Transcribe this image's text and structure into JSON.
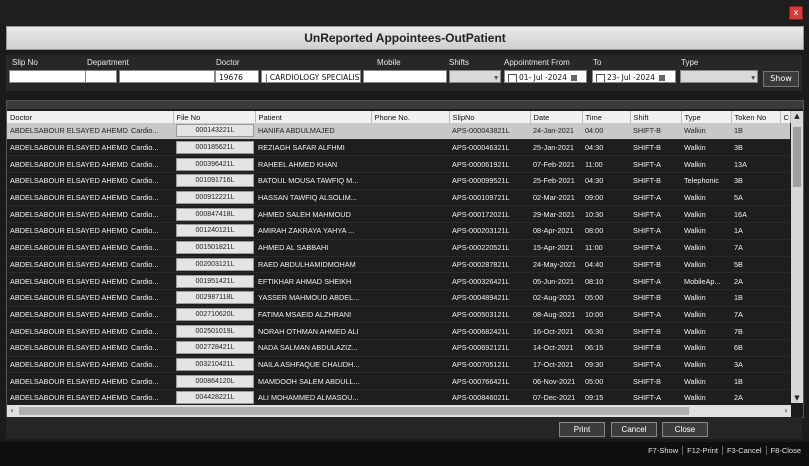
{
  "window": {
    "title": "UnReported Appointees-OutPatient",
    "close_label": "x"
  },
  "filters": {
    "slip_no": {
      "label": "Slip No",
      "value": ""
    },
    "department": {
      "label": "Department",
      "value": ""
    },
    "doctor": {
      "label": "Doctor",
      "code": "19676",
      "name": "|  CARDIOLOGY SPECIALIST"
    },
    "mobile": {
      "label": "Mobile",
      "value": ""
    },
    "shifts": {
      "label": "Shifts",
      "value": ""
    },
    "appointment_from": {
      "label": "Appointment From",
      "value": "01- Jul -2024"
    },
    "to": {
      "label": "To",
      "value": "23- Jul -2024"
    },
    "type": {
      "label": "Type",
      "value": ""
    },
    "show_label": "Show"
  },
  "grid": {
    "columns": [
      "Doctor",
      "File No",
      "Patient",
      "Phone No.",
      "SlipNo",
      "Date",
      "Time",
      "Shift",
      "Type",
      "Token No",
      "C"
    ],
    "rows": [
      {
        "doctor": "ABDELSABOUR ELSAYED AHEMD",
        "dept": "Cardio...",
        "file": "000143221L",
        "patient": "HANIFA ABDULMAJED",
        "phone": "",
        "slip": "APS-000043821L",
        "date": "24-Jan-2021",
        "time": "04:00",
        "shift": "SHIFT-B",
        "type": "Walkin",
        "token": "1B"
      },
      {
        "doctor": "ABDELSABOUR ELSAYED AHEMD",
        "dept": "Cardio...",
        "file": "000185621L",
        "patient": "REZIAGH SAFAR ALFHMI",
        "phone": "",
        "slip": "APS-000046321L",
        "date": "25-Jan-2021",
        "time": "04:30",
        "shift": "SHIFT-B",
        "type": "Walkin",
        "token": "3B"
      },
      {
        "doctor": "ABDELSABOUR ELSAYED AHEMD",
        "dept": "Cardio...",
        "file": "000396421L",
        "patient": "RAHEEL AHMED KHAN",
        "phone": "",
        "slip": "APS-000061921L",
        "date": "07-Feb-2021",
        "time": "11:00",
        "shift": "SHIFT-A",
        "type": "Walkin",
        "token": "13A"
      },
      {
        "doctor": "ABDELSABOUR ELSAYED AHEMD",
        "dept": "Cardio...",
        "file": "001091716L",
        "patient": "BATOUL MOUSA TAWFIQ M...",
        "phone": "",
        "slip": "APS-000099521L",
        "date": "25-Feb-2021",
        "time": "04:30",
        "shift": "SHIFT-B",
        "type": "Telephonic",
        "token": "3B"
      },
      {
        "doctor": "ABDELSABOUR ELSAYED AHEMD",
        "dept": "Cardio...",
        "file": "000912221L",
        "patient": "HASSAN TAWFIQ ALSOLIM...",
        "phone": "",
        "slip": "APS-000109721L",
        "date": "02-Mar-2021",
        "time": "09:00",
        "shift": "SHIFT-A",
        "type": "Walkin",
        "token": "5A"
      },
      {
        "doctor": "ABDELSABOUR ELSAYED AHEMD",
        "dept": "Cardio...",
        "file": "000847418L",
        "patient": "AHMED SALEH MAHMOUD",
        "phone": "",
        "slip": "APS-000172021L",
        "date": "29-Mar-2021",
        "time": "10:30",
        "shift": "SHIFT-A",
        "type": "Walkin",
        "token": "16A"
      },
      {
        "doctor": "ABDELSABOUR ELSAYED AHEMD",
        "dept": "Cardio...",
        "file": "001240121L",
        "patient": "AMIRAH ZAKRAYA YAHYA ...",
        "phone": "",
        "slip": "APS-000203121L",
        "date": "08-Apr-2021",
        "time": "08:00",
        "shift": "SHIFT-A",
        "type": "Walkin",
        "token": "1A"
      },
      {
        "doctor": "ABDELSABOUR ELSAYED AHEMD",
        "dept": "Cardio...",
        "file": "001501821L",
        "patient": "AHMED AL SABBAHI",
        "phone": "",
        "slip": "APS-000220521L",
        "date": "15-Apr-2021",
        "time": "11:00",
        "shift": "SHIFT-A",
        "type": "Walkin",
        "token": "7A"
      },
      {
        "doctor": "ABDELSABOUR ELSAYED AHEMD",
        "dept": "Cardio...",
        "file": "002003121L",
        "patient": "RAED ABDULHAMIDMOHAM",
        "phone": "",
        "slip": "APS-000287821L",
        "date": "24-May-2021",
        "time": "04:40",
        "shift": "SHIFT-B",
        "type": "Walkin",
        "token": "5B"
      },
      {
        "doctor": "ABDELSABOUR ELSAYED AHEMD",
        "dept": "Cardio...",
        "file": "001951421L",
        "patient": "EFTIKHAR AHMAD SHEIKH",
        "phone": "",
        "slip": "APS-000326421L",
        "date": "05-Jun-2021",
        "time": "08:10",
        "shift": "SHIFT-A",
        "type": "MobileAp...",
        "token": "2A"
      },
      {
        "doctor": "ABDELSABOUR ELSAYED AHEMD",
        "dept": "Cardio...",
        "file": "002987118L",
        "patient": "YASSER MAHMOUD ABDEL...",
        "phone": "",
        "slip": "APS-000489421L",
        "date": "02-Aug-2021",
        "time": "05:00",
        "shift": "SHIFT-B",
        "type": "Walkin",
        "token": "1B"
      },
      {
        "doctor": "ABDELSABOUR ELSAYED AHEMD",
        "dept": "Cardio...",
        "file": "002710620L",
        "patient": "FATIMA MSAEID ALZHRANI",
        "phone": "",
        "slip": "APS-000503121L",
        "date": "08-Aug-2021",
        "time": "10:00",
        "shift": "SHIFT-A",
        "type": "Walkin",
        "token": "7A"
      },
      {
        "doctor": "ABDELSABOUR ELSAYED AHEMD",
        "dept": "Cardio...",
        "file": "002501019L",
        "patient": "NORAH OTHMAN AHMED ALI",
        "phone": "",
        "slip": "APS-000682421L",
        "date": "16-Oct-2021",
        "time": "06:30",
        "shift": "SHIFT-B",
        "type": "Walkin",
        "token": "7B"
      },
      {
        "doctor": "ABDELSABOUR ELSAYED AHEMD",
        "dept": "Cardio...",
        "file": "002728421L",
        "patient": "NADA SALMAN ABDULAZIZ...",
        "phone": "",
        "slip": "APS-000692121L",
        "date": "14-Oct-2021",
        "time": "06:15",
        "shift": "SHIFT-B",
        "type": "Walkin",
        "token": "6B"
      },
      {
        "doctor": "ABDELSABOUR ELSAYED AHEMD",
        "dept": "Cardio...",
        "file": "003210421L",
        "patient": "NAILA ASHFAQUE CHAUDH...",
        "phone": "",
        "slip": "APS-000705121L",
        "date": "17-Oct-2021",
        "time": "09:30",
        "shift": "SHIFT-A",
        "type": "Walkin",
        "token": "3A"
      },
      {
        "doctor": "ABDELSABOUR ELSAYED AHEMD",
        "dept": "Cardio...",
        "file": "000864120L",
        "patient": "MAMDOOH SALEM ABDULL...",
        "phone": "",
        "slip": "APS-000766421L",
        "date": "06-Nov-2021",
        "time": "05:00",
        "shift": "SHIFT-B",
        "type": "Walkin",
        "token": "1B"
      },
      {
        "doctor": "ABDELSABOUR ELSAYED AHEMD",
        "dept": "Cardio...",
        "file": "004428221L",
        "patient": "ALI MOHAMMED ALMASOU...",
        "phone": "",
        "slip": "APS-000846021L",
        "date": "07-Dec-2021",
        "time": "09:15",
        "shift": "SHIFT-A",
        "type": "Walkin",
        "token": "2A"
      }
    ]
  },
  "buttons": {
    "print": "Print",
    "cancel": "Cancel",
    "close": "Close"
  },
  "shortcuts": [
    "F7-Show",
    "F12-Print",
    "F3-Cancel",
    "F8-Close"
  ]
}
